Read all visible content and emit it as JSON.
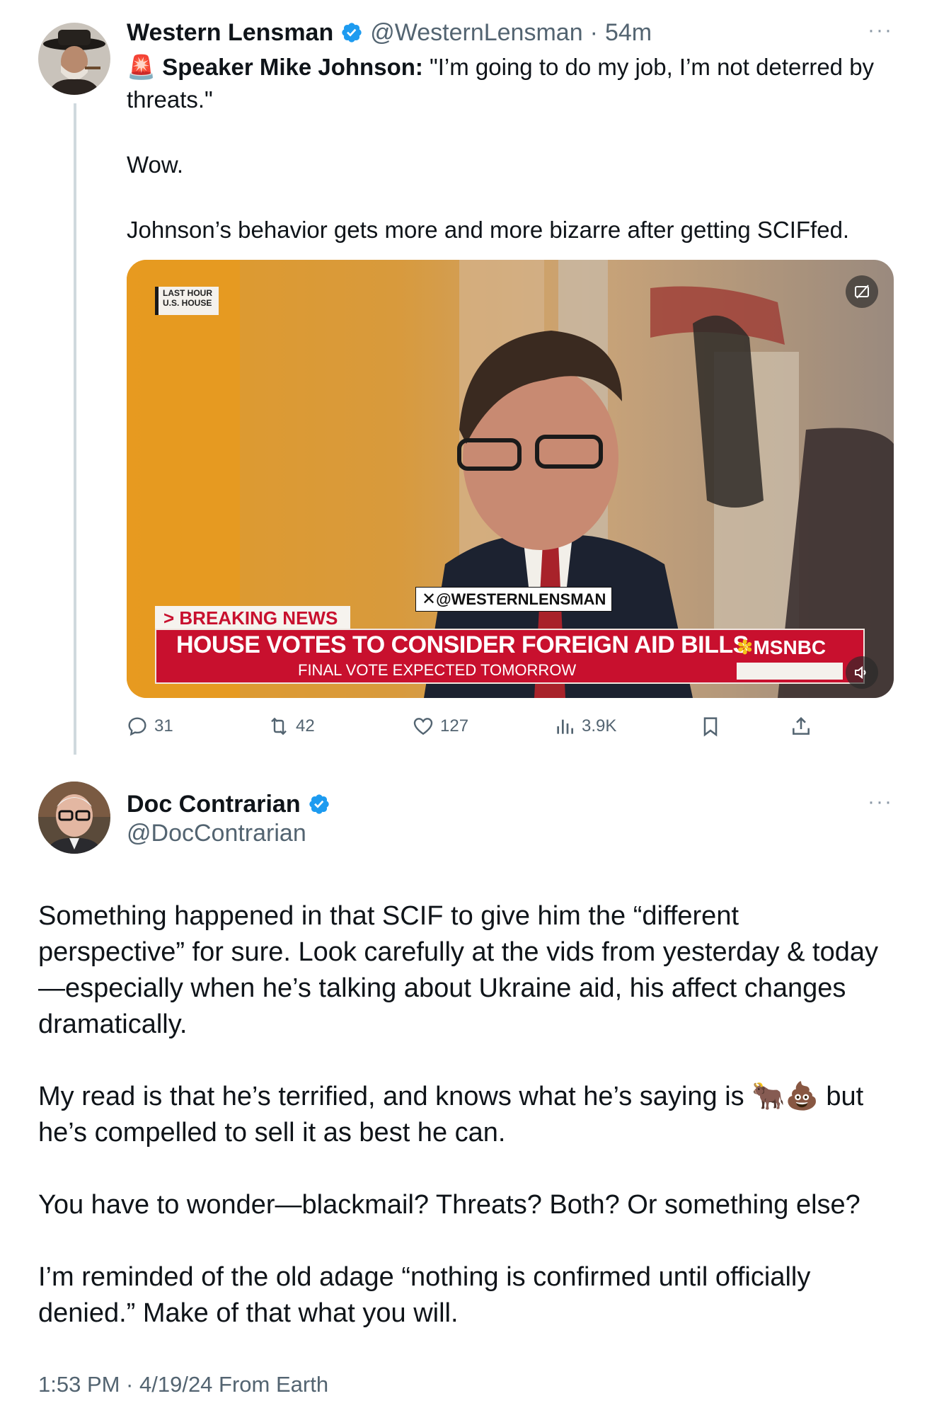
{
  "colors": {
    "verified": "#1d9bf0",
    "secondary_text": "#536471",
    "thread_line": "#cfd9de",
    "banner_red": "#c8102e"
  },
  "tweet1": {
    "author_name": "Western Lensman",
    "handle": "@WesternLensman",
    "time": "54m",
    "separator": "·",
    "more": "···",
    "siren_icon": "🚨",
    "lead_bold": "Speaker Mike Johnson:",
    "quote_line1": " \"I’m going to do my job, I’m not deterred by",
    "quote_line2": "threats.\"",
    "para2": "Wow.",
    "para3": "Johnson’s behavior gets more and more bizarre after getting SCIFfed.",
    "media": {
      "bug_line1": "LAST HOUR",
      "bug_line2": "U.S. HOUSE",
      "watermark": "@WESTERNLENSMAN",
      "breaking_tag": "> BREAKING NEWS",
      "headline": "HOUSE VOTES TO CONSIDER FOREIGN AID BILLS",
      "subheadline": "FINAL VOTE EXPECTED TOMORROW",
      "network": "MSNBC"
    },
    "stats": {
      "replies": "31",
      "reposts": "42",
      "likes": "127",
      "views": "3.9K"
    }
  },
  "tweet2": {
    "author_name": "Doc Contrarian",
    "handle": "@DocContrarian",
    "more": "···",
    "p1_l1": "Something happened in that SCIF to give him the “different",
    "p1_l2": "perspective” for sure. Look carefully at the vids from yesterday & today",
    "p1_l3": "—especially when he’s talking about Ukraine aid, his affect changes",
    "p1_l4": "dramatically.",
    "p2_l1a": "My read is that he’s terrified, and knows what he’s saying is ",
    "p2_emoji": "🐂💩",
    "p2_l1b": " but",
    "p2_l2": "he’s compelled to sell it as best he can.",
    "p3": "You have to wonder—blackmail? Threats? Both? Or something else?",
    "p4_l1": "I’m reminded of the old adage “nothing is confirmed until officially",
    "p4_l2": "denied.” Make of that what you will.",
    "footer": "1:53 PM · 4/19/24 From Earth"
  }
}
